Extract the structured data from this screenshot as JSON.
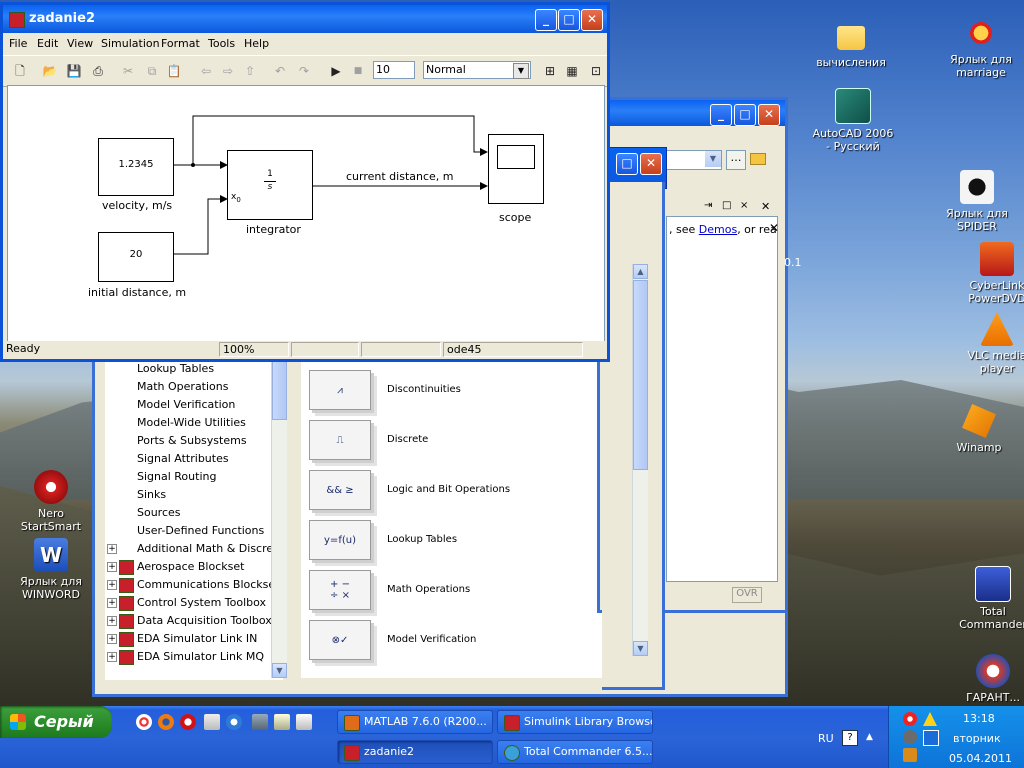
{
  "desktop": {
    "icons": [
      {
        "label": "вычисления",
        "icon": "folder-icon"
      },
      {
        "label": "Ярлык для marriage",
        "icon": "marriage-shortcut-icon"
      },
      {
        "label": "AutoCAD 2006 - Русский",
        "icon": "autocad-icon"
      },
      {
        "label": "Ярлык для SPIDER",
        "icon": "spider-icon"
      },
      {
        "label": "CyberLink PowerDVD",
        "icon": "powerdvd-icon"
      },
      {
        "label": "VLC media player",
        "icon": "vlc-icon"
      },
      {
        "label": "Winamp",
        "icon": "winamp-icon"
      },
      {
        "label": "Nero StartSmart",
        "icon": "nero-icon"
      },
      {
        "label": "Ярлык для WINWORD",
        "icon": "word-icon"
      },
      {
        "label": "Total Commander",
        "icon": "total-commander-icon"
      },
      {
        "label": "ГАРАНТ...",
        "icon": "garant-icon"
      }
    ]
  },
  "model_window": {
    "title": "zadanie2",
    "menu": [
      "File",
      "Edit",
      "View",
      "Simulation",
      "Format",
      "Tools",
      "Help"
    ],
    "stop_time": "10",
    "sim_mode": "Normal",
    "blocks": {
      "velocity_value": "1.2345",
      "velocity_label": "velocity, m/s",
      "initial_value": "20",
      "initial_label": "initial distance, m",
      "integrator_num": "1",
      "integrator_den": "s",
      "integrator_port": "x",
      "integrator_port_sub": "0",
      "integrator_label": "integrator",
      "scope_label": "scope",
      "signal_label": "current distance, m"
    },
    "status": {
      "state": "Ready",
      "zoom": "100%",
      "solver": "ode45"
    }
  },
  "matlab_window": {
    "demos_prefix": ", see",
    "demos_link": "Demos",
    "demos_suffix": ", or rea",
    "side_text": "0.1",
    "ovr": "OVR"
  },
  "library_browser": {
    "tree": [
      {
        "label": "Lookup Tables",
        "icon": false
      },
      {
        "label": "Math Operations",
        "icon": false
      },
      {
        "label": "Model Verification",
        "icon": false
      },
      {
        "label": "Model-Wide Utilities",
        "icon": false
      },
      {
        "label": "Ports & Subsystems",
        "icon": false
      },
      {
        "label": "Signal Attributes",
        "icon": false
      },
      {
        "label": "Signal Routing",
        "icon": false
      },
      {
        "label": "Sinks",
        "icon": false
      },
      {
        "label": "Sources",
        "icon": false
      },
      {
        "label": "User-Defined Functions",
        "icon": false
      },
      {
        "label": "Additional Math & Discrete",
        "icon": false
      },
      {
        "label": "Aerospace Blockset",
        "icon": true
      },
      {
        "label": "Communications Blockset",
        "icon": true
      },
      {
        "label": "Control System Toolbox",
        "icon": true
      },
      {
        "label": "Data Acquisition Toolbox",
        "icon": true
      },
      {
        "label": "EDA Simulator Link IN",
        "icon": true
      },
      {
        "label": "EDA Simulator Link MQ",
        "icon": true
      }
    ],
    "blocks": [
      {
        "label": "Discontinuities",
        "glyph": "⩘"
      },
      {
        "label": "Discrete",
        "glyph": "⎍"
      },
      {
        "label": "Logic and Bit Operations",
        "glyph": "&& ≥"
      },
      {
        "label": "Lookup Tables",
        "glyph": "y=f(u)"
      },
      {
        "label": "Math Operations",
        "glyph": "+ −\n÷ ×"
      },
      {
        "label": "Model Verification",
        "glyph": "⊗✓"
      }
    ]
  },
  "taskbar": {
    "start_label": "Серый",
    "tasks": [
      {
        "label": "MATLAB 7.6.0 (R200..."
      },
      {
        "label": "Simulink Library Browser"
      },
      {
        "label": "zadanie2"
      },
      {
        "label": "Total Commander 6.5..."
      }
    ],
    "lang": "RU",
    "time": "13:18",
    "weekday": "вторник",
    "date": "05.04.2011"
  }
}
